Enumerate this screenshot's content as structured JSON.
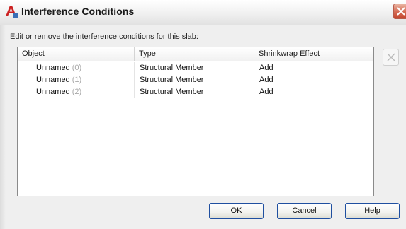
{
  "window": {
    "title": "Interference Conditions"
  },
  "instruction": "Edit or remove the interference conditions for this slab:",
  "table": {
    "columns": [
      "Object",
      "Type",
      "Shrinkwrap Effect"
    ],
    "rows": [
      {
        "object_name": "Unnamed",
        "object_index": "(0)",
        "type": "Structural Member",
        "effect": "Add"
      },
      {
        "object_name": "Unnamed",
        "object_index": "(1)",
        "type": "Structural Member",
        "effect": "Add"
      },
      {
        "object_name": "Unnamed",
        "object_index": "(2)",
        "type": "Structural Member",
        "effect": "Add"
      }
    ]
  },
  "buttons": {
    "ok": "OK",
    "cancel": "Cancel",
    "help": "Help"
  },
  "icons": {
    "app": "autocad-logo-icon",
    "close": "close-icon",
    "delete": "remove-x-icon"
  },
  "colors": {
    "close_button": "#d24f33",
    "app_logo": "#cc2020",
    "index_text": "#a8a8a8",
    "button_border": "#1f4fa0"
  }
}
